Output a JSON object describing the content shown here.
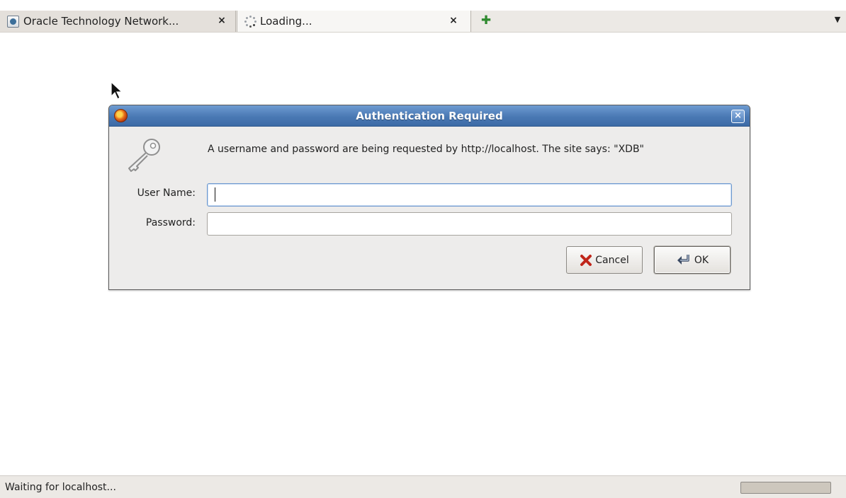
{
  "tabs": [
    {
      "title": "Oracle Technology Network...",
      "state": "loaded",
      "close_label": "×"
    },
    {
      "title": "Loading...",
      "state": "loading",
      "close_label": "×"
    }
  ],
  "new_tab_label": "✚",
  "tab_list_label": "▼",
  "dialog": {
    "title": "Authentication Required",
    "close_label": "×",
    "message": "A username and password are being requested by http://localhost. The site says: \"XDB\"",
    "username_label": "User Name:",
    "username_value": "",
    "password_label": "Password:",
    "password_value": "",
    "cancel_label": "Cancel",
    "ok_label": "OK"
  },
  "status": {
    "text": "Waiting for localhost...",
    "progress": 0
  },
  "colors": {
    "titlebar": "#4a79b4",
    "dialog_bg": "#edeceb",
    "tabbar_bg": "#ece9e5"
  }
}
